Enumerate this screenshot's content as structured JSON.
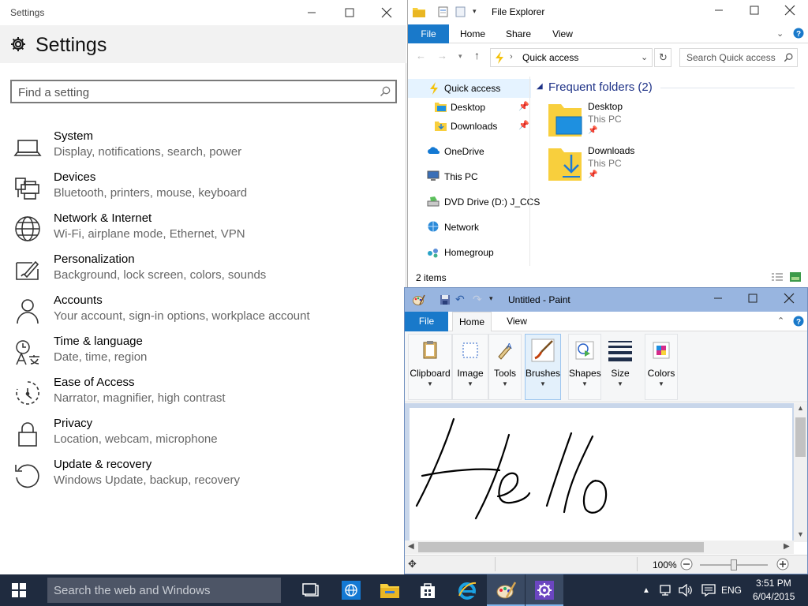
{
  "settings": {
    "window_title": "Settings",
    "heading": "Settings",
    "search_placeholder": "Find a setting",
    "categories": [
      {
        "title": "System",
        "desc": "Display, notifications, search, power",
        "icon": "laptop-icon"
      },
      {
        "title": "Devices",
        "desc": "Bluetooth, printers, mouse, keyboard",
        "icon": "devices-icon"
      },
      {
        "title": "Network & Internet",
        "desc": "Wi-Fi, airplane mode, Ethernet, VPN",
        "icon": "globe-icon"
      },
      {
        "title": "Personalization",
        "desc": "Background, lock screen, colors, sounds",
        "icon": "personalization-icon"
      },
      {
        "title": "Accounts",
        "desc": "Your account, sign-in options, workplace account",
        "icon": "person-icon"
      },
      {
        "title": "Time & language",
        "desc": "Date, time, region",
        "icon": "time-language-icon"
      },
      {
        "title": "Ease of Access",
        "desc": "Narrator, magnifier, high contrast",
        "icon": "ease-of-access-icon"
      },
      {
        "title": "Privacy",
        "desc": "Location, webcam, microphone",
        "icon": "lock-icon"
      },
      {
        "title": "Update & recovery",
        "desc": "Windows Update, backup, recovery",
        "icon": "update-icon"
      }
    ]
  },
  "explorer": {
    "window_title": "File Explorer",
    "tabs": [
      "File",
      "Home",
      "Share",
      "View"
    ],
    "address": "Quick access",
    "search_placeholder": "Search Quick access",
    "nav": [
      {
        "label": "Quick access",
        "icon": "quick-access-icon"
      },
      {
        "label": "Desktop",
        "icon": "desktop-folder-icon"
      },
      {
        "label": "Downloads",
        "icon": "downloads-folder-icon"
      },
      {
        "label": "OneDrive",
        "icon": "onedrive-icon"
      },
      {
        "label": "This PC",
        "icon": "this-pc-icon"
      },
      {
        "label": "DVD Drive (D:) J_CCS",
        "icon": "dvd-drive-icon"
      },
      {
        "label": "Network",
        "icon": "network-icon"
      },
      {
        "label": "Homegroup",
        "icon": "homegroup-icon"
      }
    ],
    "group_header": "Frequent folders (2)",
    "folders": [
      {
        "name": "Desktop",
        "location": "This PC"
      },
      {
        "name": "Downloads",
        "location": "This PC"
      }
    ],
    "status": "2 items"
  },
  "paint": {
    "window_title": "Untitled - Paint",
    "tabs": [
      "File",
      "Home",
      "View"
    ],
    "groups": [
      "Clipboard",
      "Image",
      "Tools",
      "Brushes",
      "Shapes",
      "Size",
      "Colors"
    ],
    "zoom": "100%"
  },
  "taskbar": {
    "search_placeholder": "Search the web and Windows",
    "language": "ENG",
    "time": "3:51 PM",
    "date": "6/04/2015"
  },
  "colors": {
    "accent_blue": "#1979ca",
    "taskbar": "#1f2b3f",
    "paint_titlebar": "#98b5e0",
    "folder_yellow": "#f8cf3d"
  }
}
